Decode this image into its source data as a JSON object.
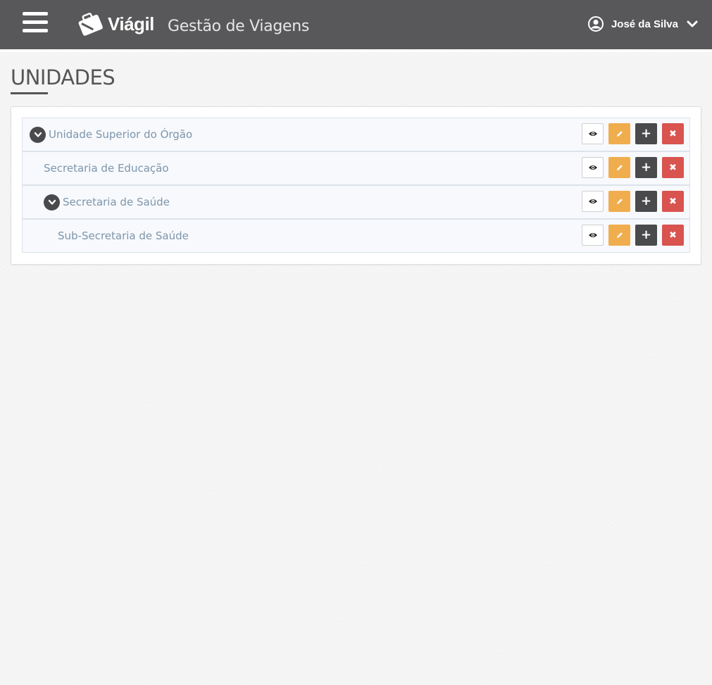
{
  "header": {
    "logo_text": "Viágil",
    "app_title": "Gestão de Viagens",
    "user_name": "José da Silva"
  },
  "page": {
    "title": "UNIDADES"
  },
  "tree": {
    "rows": [
      {
        "label": "Unidade Superior do Órgão",
        "expandable": true,
        "expanded": true,
        "level": 0
      },
      {
        "label": "Secretaria de Educação",
        "expandable": false,
        "level": 1
      },
      {
        "label": "Secretaria de Saúde",
        "expandable": true,
        "expanded": true,
        "level": 1
      },
      {
        "label": "Sub-Secretaria de Saúde",
        "expandable": false,
        "level": 2
      }
    ]
  },
  "colors": {
    "topbar": "#58585a",
    "edit": "#f0ad4e",
    "add": "#4a4a4d",
    "delete": "#d9534f",
    "label": "#7d95ab"
  },
  "icons": {
    "view": "eye-icon",
    "edit": "pencil-icon",
    "add": "plus-icon",
    "delete": "close-icon"
  }
}
